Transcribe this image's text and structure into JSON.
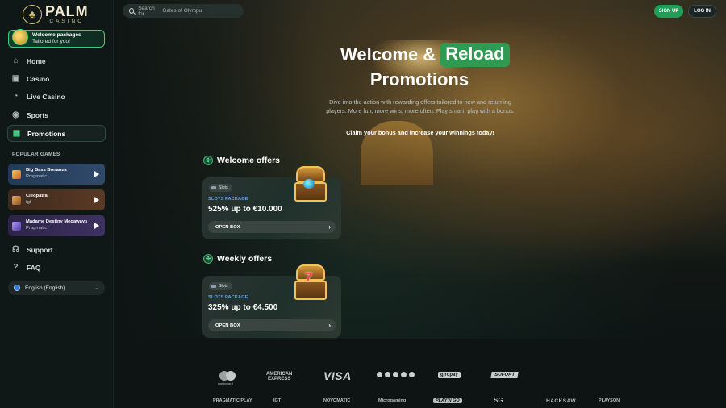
{
  "brand": {
    "name": "PALM",
    "sub": "CASINO"
  },
  "welcome_package": {
    "line1": "Welcome packages",
    "line2": "Tailored for you!"
  },
  "nav": {
    "home": "Home",
    "casino": "Casino",
    "live_casino": "Live Casino",
    "sports": "Sports",
    "promotions": "Promotions",
    "support": "Support",
    "faq": "FAQ"
  },
  "popular_label": "POPULAR GAMES",
  "games": [
    {
      "title": "Big Bass Bonanza",
      "provider": "Pragmatic"
    },
    {
      "title": "Cleopatra",
      "provider": "Igt"
    },
    {
      "title": "Madame Destiny Megaways",
      "provider": "Pragmatic"
    }
  ],
  "language": "English (English)",
  "search": {
    "label": "Search for",
    "placeholder": "Gates of Olympu"
  },
  "header": {
    "signup": "SIGN UP",
    "login": "LOG IN"
  },
  "hero": {
    "title_part1": "Welcome &",
    "title_highlight": "Reload",
    "title_line2": "Promotions",
    "description": "Dive into the action with rewarding offers tailored to new and returning players. More fun, more wins, more often. Play smart, play with a bonus.",
    "claim": "Claim your bonus and increase your winnings today!"
  },
  "sections": [
    {
      "title": "Welcome offers",
      "card": {
        "tag": "Slots",
        "kicker": "SLOTS PACKAGE",
        "amount": "525% up to €10.000",
        "button": "OPEN BOX"
      }
    },
    {
      "title": "Weekly offers",
      "card": {
        "tag": "Slots",
        "kicker": "SLOTS PACKAGE",
        "amount": "325% up to €4.500",
        "button": "OPEN BOX"
      }
    }
  ],
  "payments": {
    "mastercard_sub": "mastercard",
    "amex_l1": "AMERICAN",
    "amex_l2": "EXPRESS",
    "visa": "VISA",
    "giropay": "giropay",
    "sofort": "SOFORT"
  },
  "providers": {
    "pragmatic": "PRAGMATIC PLAY",
    "igt": "IGT",
    "novomatic": "NOVOMATIC",
    "microgaming": "Microgaming",
    "play5": "PLAY'N GO",
    "sg": "SG",
    "hacksaw": "HACKSAW",
    "playson": "PLAYSON"
  }
}
